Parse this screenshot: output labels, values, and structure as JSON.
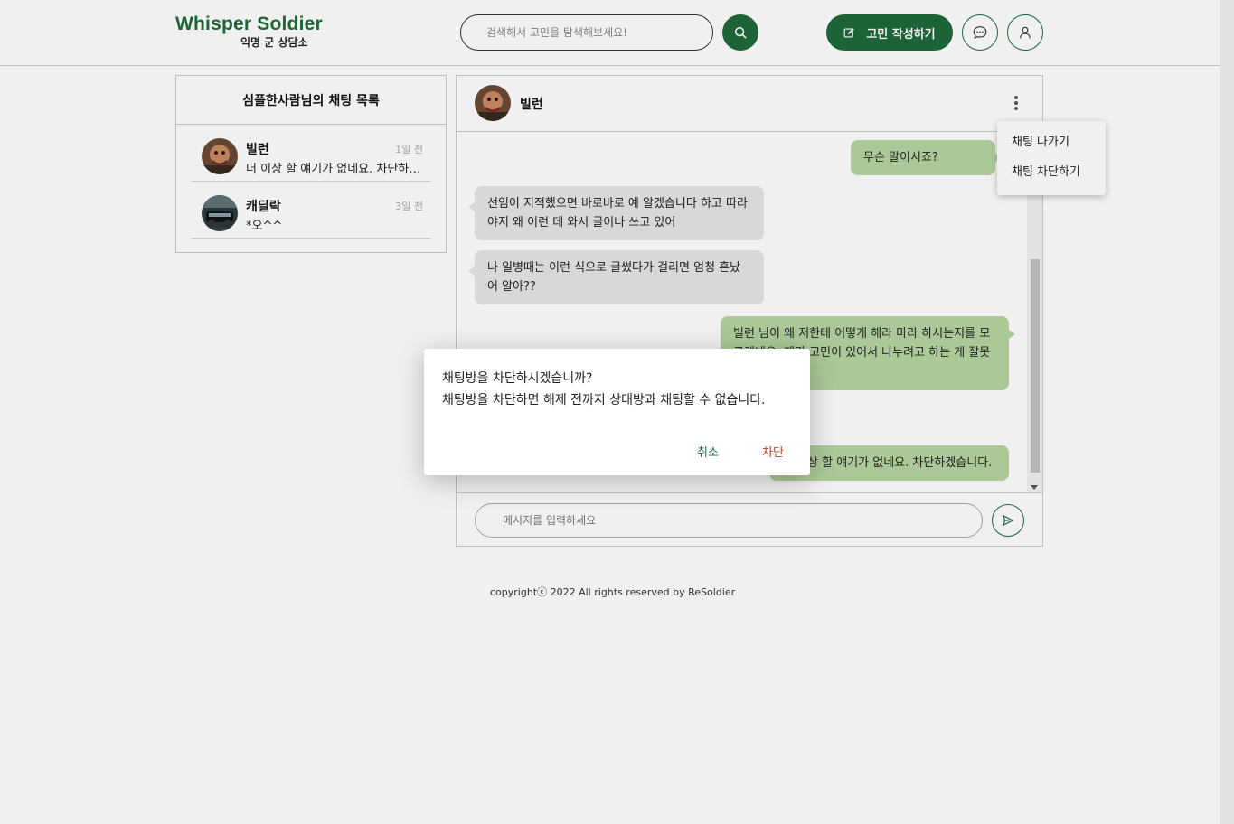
{
  "header": {
    "logo_title": "Whisper Soldier",
    "logo_subtitle": "익명 군 상담소",
    "search_placeholder": "검색해서 고민을 탐색해보세요!",
    "write_label": "고민 작성하기"
  },
  "chat_list": {
    "title": "심플한사람님의 채팅 목록",
    "items": [
      {
        "name": "빌런",
        "time": "1일 전",
        "last_message": "더 이상 할 얘기가 없네요. 차단하겠습니다."
      },
      {
        "name": "캐딜락",
        "time": "3일 전",
        "last_message": "*오^^"
      }
    ]
  },
  "chat_room": {
    "partner_name": "빌런",
    "messages": [
      {
        "from": "me",
        "text": "무슨 말이시죠?"
      },
      {
        "from": "other",
        "text": "선임이 지적했으면 바로바로 예 알겠습니다 하고 따라야지 왜 이런 데 와서 글이나 쓰고 있어"
      },
      {
        "from": "other",
        "text": "나 일병때는 이런 식으로 글썼다가 걸리면 엄청 혼났어 알아??"
      },
      {
        "from": "me",
        "text": "빌런 님이 왜 저한테 어떻게 해라 마라 하시는지를 모르겠네요. 제가 고민이 있어서 나누려고 하는 게 잘못인가요?"
      },
      {
        "from": "me",
        "text": "더 이상 할 얘기가 없네요. 차단하겠습니다."
      }
    ],
    "input_placeholder": "메시지를 입력하세요"
  },
  "dropdown": {
    "leave": "채팅 나가기",
    "block": "채팅 차단하기"
  },
  "modal": {
    "title": "채팅방을 차단하시겠습니까?",
    "description": "채팅방을 차단하면 해제 전까지 상대방과 채팅할 수 없습니다.",
    "cancel": "취소",
    "confirm": "차단"
  },
  "footer": {
    "copyright": "copyrightⓒ 2022 All rights reserved by ReSoldier"
  },
  "colors": {
    "brand": "#1e6b3c",
    "mine_bubble": "#b6d6a1",
    "other_bubble": "#e6e6e6",
    "danger": "#b7442a"
  }
}
